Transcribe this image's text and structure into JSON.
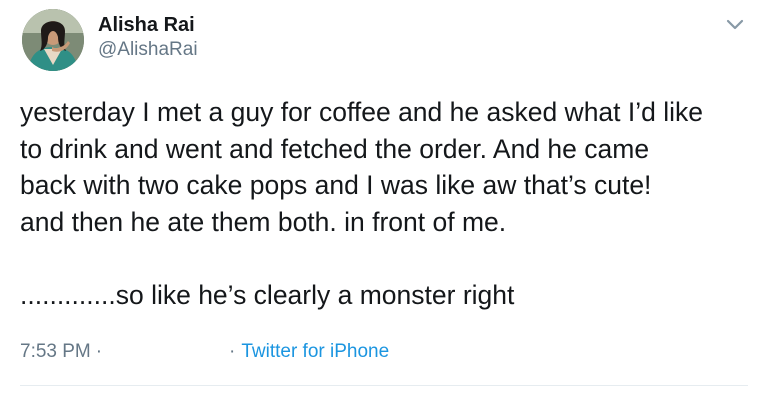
{
  "author": {
    "display_name": "Alisha Rai",
    "handle": "@AlishaRai",
    "avatar_icon": "profile-photo"
  },
  "tweet": {
    "text": "yesterday I met a guy for coffee and he asked what I’d like\nto drink and went and fetched the order. And he came\nback with two cake pops and I was like aw that’s cute!\nand then he ate them both. in front of me.\n\n.............so like he’s clearly a monster right"
  },
  "meta": {
    "time": "7:53 PM",
    "separator": "·",
    "source": "Twitter for iPhone"
  },
  "menu": {
    "caret_icon": "chevron-down-icon"
  },
  "colors": {
    "text_primary": "#14171a",
    "text_secondary": "#657786",
    "link": "#1b95e0",
    "divider": "#e6ecf0"
  }
}
